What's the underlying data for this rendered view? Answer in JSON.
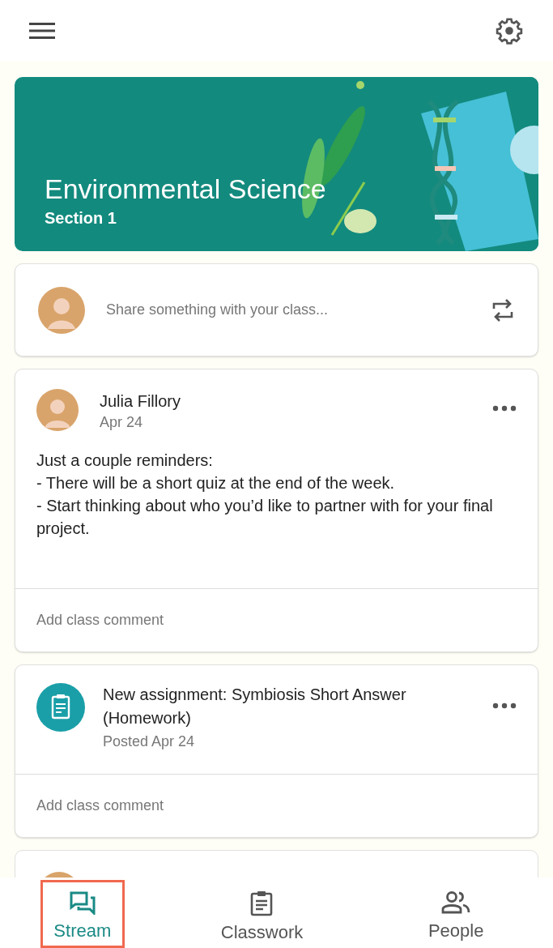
{
  "class_banner": {
    "title": "Environmental Science",
    "section": "Section 1"
  },
  "share_box": {
    "placeholder": "Share something with your class..."
  },
  "posts": [
    {
      "kind": "announcement",
      "author": "Julia Fillory",
      "date": "Apr 24",
      "body": "Just a couple reminders:\n- There will be a short quiz at the end of the week.\n- Start thinking about who you’d like to partner with for your final project.",
      "comment_placeholder": "Add class comment"
    },
    {
      "kind": "assignment",
      "title": "New assignment: Symbiosis Short Answer (Homework)",
      "date": "Posted Apr 24",
      "comment_placeholder": "Add class comment"
    }
  ],
  "bottom_nav": [
    {
      "kind": "stream",
      "label": "Stream",
      "selected": true
    },
    {
      "kind": "classwork",
      "label": "Classwork",
      "selected": false
    },
    {
      "kind": "people",
      "label": "People",
      "selected": false
    }
  ]
}
